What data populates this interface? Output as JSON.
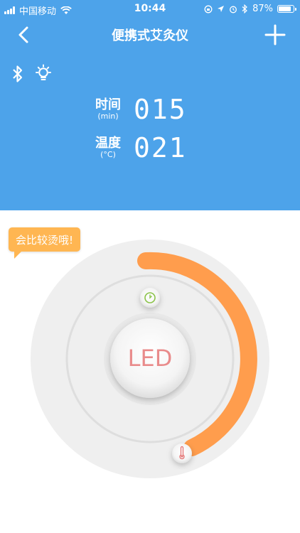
{
  "status_bar": {
    "carrier": "中国移动",
    "time": "10:44",
    "battery_percent_label": "87%",
    "battery_level": 0.87
  },
  "nav": {
    "title": "便携式艾灸仪"
  },
  "readings": {
    "time": {
      "label": "时间",
      "unit": "(min)",
      "value": "015"
    },
    "temperature": {
      "label": "温度",
      "unit": "(°C)",
      "value": "021"
    }
  },
  "tooltip": {
    "text": "会比较烫哦!"
  },
  "dial": {
    "center_label": "LED",
    "progress_color": "#ff9d4d",
    "header_color": "#4da3ea",
    "top_knob_icon": "timer-icon",
    "bottom_knob_icon": "thermometer-icon"
  }
}
